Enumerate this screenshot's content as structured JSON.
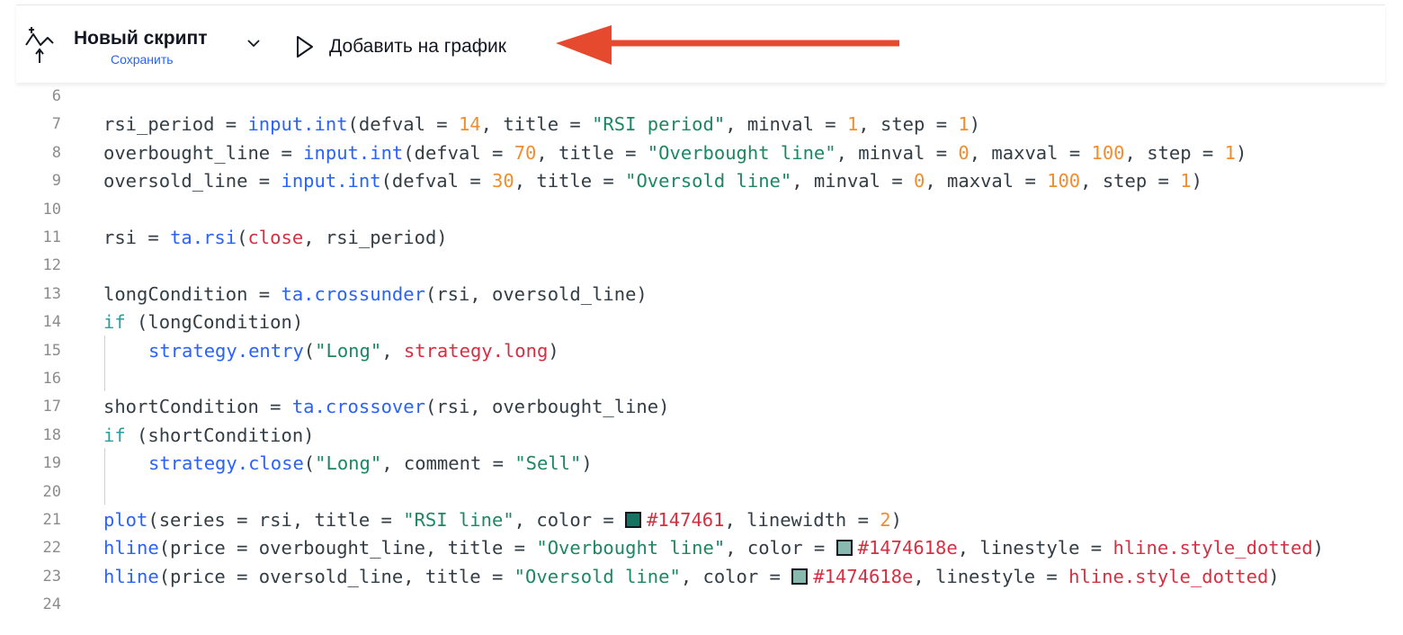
{
  "toolbar": {
    "script_title": "Новый скрипт",
    "save_label": "Сохранить",
    "add_to_chart_label": "Добавить на график",
    "icons": {
      "script": "script-icon",
      "dropdown": "chevron-down-icon",
      "run": "play-icon"
    }
  },
  "annotation": {
    "arrow_color": "#e64a2e"
  },
  "colors": {
    "keyword": "#22a39f",
    "function": "#2962ff",
    "number": "#ef8e31",
    "string": "#1d8762",
    "variable": "#d62f42",
    "swatch_line": "#147461",
    "swatch_hline": "#88b9af"
  },
  "editor": {
    "lines": [
      {
        "num": "6",
        "indent": false,
        "tokens": []
      },
      {
        "num": "7",
        "indent": false,
        "tokens": [
          {
            "t": "rsi_period = "
          },
          {
            "t": "input.int",
            "c": "f"
          },
          {
            "t": "(defval = "
          },
          {
            "t": "14",
            "c": "n"
          },
          {
            "t": ", title = "
          },
          {
            "t": "\"RSI period\"",
            "c": "s"
          },
          {
            "t": ", minval = "
          },
          {
            "t": "1",
            "c": "n"
          },
          {
            "t": ", step = "
          },
          {
            "t": "1",
            "c": "n"
          },
          {
            "t": ")"
          }
        ]
      },
      {
        "num": "8",
        "indent": false,
        "tokens": [
          {
            "t": "overbought_line = "
          },
          {
            "t": "input.int",
            "c": "f"
          },
          {
            "t": "(defval = "
          },
          {
            "t": "70",
            "c": "n"
          },
          {
            "t": ", title = "
          },
          {
            "t": "\"Overbought line\"",
            "c": "s"
          },
          {
            "t": ", minval = "
          },
          {
            "t": "0",
            "c": "n"
          },
          {
            "t": ", maxval = "
          },
          {
            "t": "100",
            "c": "n"
          },
          {
            "t": ", step = "
          },
          {
            "t": "1",
            "c": "n"
          },
          {
            "t": ")"
          }
        ]
      },
      {
        "num": "9",
        "indent": false,
        "tokens": [
          {
            "t": "oversold_line = "
          },
          {
            "t": "input.int",
            "c": "f"
          },
          {
            "t": "(defval = "
          },
          {
            "t": "30",
            "c": "n"
          },
          {
            "t": ", title = "
          },
          {
            "t": "\"Oversold line\"",
            "c": "s"
          },
          {
            "t": ", minval = "
          },
          {
            "t": "0",
            "c": "n"
          },
          {
            "t": ", maxval = "
          },
          {
            "t": "100",
            "c": "n"
          },
          {
            "t": ", step = "
          },
          {
            "t": "1",
            "c": "n"
          },
          {
            "t": ")"
          }
        ]
      },
      {
        "num": "10",
        "indent": false,
        "tokens": []
      },
      {
        "num": "11",
        "indent": false,
        "tokens": [
          {
            "t": "rsi = "
          },
          {
            "t": "ta.rsi",
            "c": "f"
          },
          {
            "t": "("
          },
          {
            "t": "close",
            "c": "v"
          },
          {
            "t": ", rsi_period)"
          }
        ]
      },
      {
        "num": "12",
        "indent": false,
        "tokens": []
      },
      {
        "num": "13",
        "indent": false,
        "tokens": [
          {
            "t": "longCondition = "
          },
          {
            "t": "ta.crossunder",
            "c": "f"
          },
          {
            "t": "(rsi, oversold_line)"
          }
        ]
      },
      {
        "num": "14",
        "indent": false,
        "tokens": [
          {
            "t": "if",
            "c": "k"
          },
          {
            "t": " (longCondition)"
          }
        ]
      },
      {
        "num": "15",
        "indent": true,
        "tokens": [
          {
            "t": "strategy.entry",
            "c": "f"
          },
          {
            "t": "("
          },
          {
            "t": "\"Long\"",
            "c": "s"
          },
          {
            "t": ", "
          },
          {
            "t": "strategy.long",
            "c": "v"
          },
          {
            "t": ")"
          }
        ]
      },
      {
        "num": "16",
        "indent": false,
        "tokens": []
      },
      {
        "num": "17",
        "indent": false,
        "tokens": [
          {
            "t": "shortCondition = "
          },
          {
            "t": "ta.crossover",
            "c": "f"
          },
          {
            "t": "(rsi, overbought_line)"
          }
        ]
      },
      {
        "num": "18",
        "indent": false,
        "tokens": [
          {
            "t": "if",
            "c": "k"
          },
          {
            "t": " (shortCondition)"
          }
        ]
      },
      {
        "num": "19",
        "indent": true,
        "tokens": [
          {
            "t": "strategy.close",
            "c": "f"
          },
          {
            "t": "("
          },
          {
            "t": "\"Long\"",
            "c": "s"
          },
          {
            "t": ", comment = "
          },
          {
            "t": "\"Sell\"",
            "c": "s"
          },
          {
            "t": ")"
          }
        ]
      },
      {
        "num": "20",
        "indent": false,
        "tokens": []
      },
      {
        "num": "21",
        "indent": false,
        "tokens": [
          {
            "t": "plot",
            "c": "f"
          },
          {
            "t": "(series = rsi, title = "
          },
          {
            "t": "\"RSI line\"",
            "c": "s"
          },
          {
            "t": ", color = "
          },
          {
            "sw": "#147461"
          },
          {
            "t": "#147461",
            "c": "v"
          },
          {
            "t": ", linewidth = "
          },
          {
            "t": "2",
            "c": "n"
          },
          {
            "t": ")"
          }
        ]
      },
      {
        "num": "22",
        "indent": false,
        "tokens": [
          {
            "t": "hline",
            "c": "f"
          },
          {
            "t": "(price = overbought_line, title = "
          },
          {
            "t": "\"Overbought line\"",
            "c": "s"
          },
          {
            "t": ", color = "
          },
          {
            "sw": "#88b9af"
          },
          {
            "t": "#1474618e",
            "c": "v"
          },
          {
            "t": ", linestyle = "
          },
          {
            "t": "hline.style_dotted",
            "c": "v"
          },
          {
            "t": ")"
          }
        ]
      },
      {
        "num": "23",
        "indent": false,
        "tokens": [
          {
            "t": "hline",
            "c": "f"
          },
          {
            "t": "(price = oversold_line, title = "
          },
          {
            "t": "\"Oversold line\"",
            "c": "s"
          },
          {
            "t": ", color = "
          },
          {
            "sw": "#88b9af"
          },
          {
            "t": "#1474618e",
            "c": "v"
          },
          {
            "t": ", linestyle = "
          },
          {
            "t": "hline.style_dotted",
            "c": "v"
          },
          {
            "t": ")"
          }
        ]
      },
      {
        "num": "24",
        "indent": false,
        "tokens": []
      }
    ]
  }
}
